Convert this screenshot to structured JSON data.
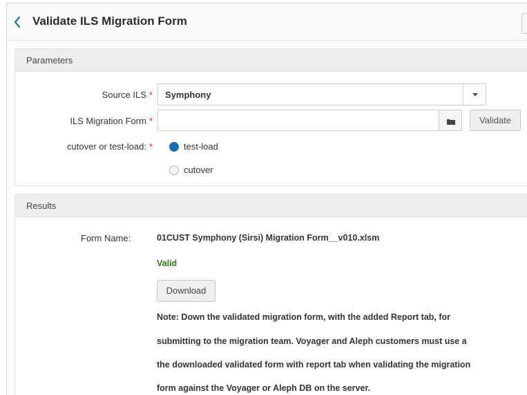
{
  "header": {
    "title": "Validate ILS Migration Form"
  },
  "parameters": {
    "section_title": "Parameters",
    "source_ils": {
      "label": "Source ILS",
      "value": "Symphony"
    },
    "migration_form": {
      "label": "ILS Migration Form",
      "value": "",
      "validate_label": "Validate"
    },
    "mode": {
      "label": "cutover or test-load:",
      "options": [
        {
          "label": "test-load",
          "selected": true
        },
        {
          "label": "cutover",
          "selected": false
        }
      ]
    },
    "required_mark": "*"
  },
  "results": {
    "section_title": "Results",
    "form_name_label": "Form Name:",
    "form_name": "01CUST Symphony (Sirsi) Migration Form__v010.xlsm",
    "status": "Valid",
    "download_label": "Download",
    "note_lines": [
      "Note: Down the validated migration form, with the added Report tab, for",
      "submitting to the migration team. Voyager and Aleph customers must use a",
      "the downloaded validated form with report tab when validating the migration",
      "form against the Voyager or Aleph DB on the server."
    ]
  },
  "colors": {
    "accent": "#1a6fb4",
    "required": "#dd2222",
    "valid": "#2a7a14"
  }
}
